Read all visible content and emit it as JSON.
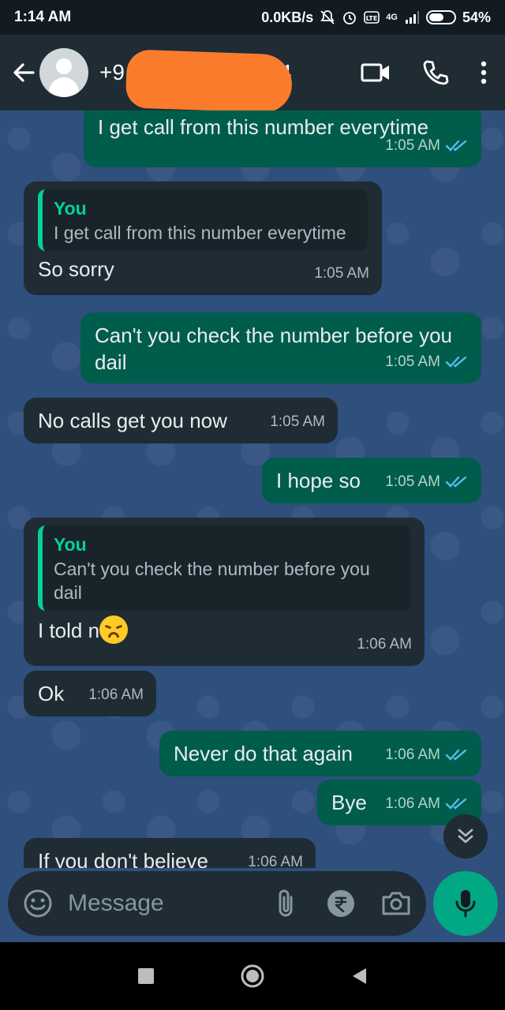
{
  "status_bar": {
    "time": "1:14 AM",
    "speed": "0.0KB/s",
    "network": "4G",
    "battery": "54%"
  },
  "header": {
    "contact_visible": "+9",
    "contact_tail": "4"
  },
  "messages": [
    {
      "id": "m1",
      "dir": "out",
      "text": "I get call from this number everytime",
      "time": "1:05 AM"
    },
    {
      "id": "m2",
      "dir": "in",
      "reply_who": "You",
      "reply_text": "I get call from this number everytime",
      "text": "So sorry",
      "time": "1:05 AM"
    },
    {
      "id": "m3",
      "dir": "out",
      "text": "Can't you check the number before you dail",
      "time": "1:05 AM"
    },
    {
      "id": "m4",
      "dir": "in",
      "text": "No calls get you now",
      "time": "1:05 AM"
    },
    {
      "id": "m5",
      "dir": "out",
      "text": "I hope so",
      "time": "1:05 AM"
    },
    {
      "id": "m6",
      "dir": "in",
      "reply_who": "You",
      "reply_text": "Can't you check the number before you dail",
      "text": "I told n",
      "time": "1:06 AM"
    },
    {
      "id": "m7",
      "dir": "in",
      "text": "Ok",
      "time": "1:06 AM"
    },
    {
      "id": "m8",
      "dir": "out",
      "text": "Never do that again",
      "time": "1:06 AM"
    },
    {
      "id": "m9",
      "dir": "out",
      "text": "Bye",
      "time": "1:06 AM"
    },
    {
      "id": "m10",
      "dir": "in",
      "text": "If you don't believe",
      "time": "1:06 AM"
    }
  ],
  "composer": {
    "placeholder": "Message"
  },
  "colors": {
    "outgoing_bubble": "#005c4b",
    "incoming_bubble": "#1f2c34",
    "accent": "#00a884",
    "read_tick": "#53bdeb"
  }
}
